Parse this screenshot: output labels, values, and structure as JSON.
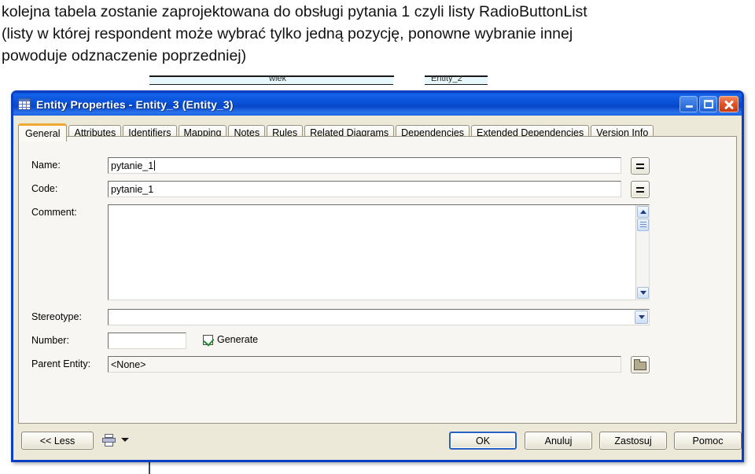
{
  "caption": {
    "line1": "kolejna tabela zostanie zaprojektowana do obsługi pytania 1 czyli listy RadioButtonList",
    "line2": "(listy w której respondent może wybrać tylko jedną pozycję, ponowne wybranie innej",
    "line3": "powoduje odznaczenie poprzedniej)"
  },
  "backdrop": {
    "label_left": "wiek",
    "label_right": "Entity_2"
  },
  "dialog": {
    "title": "Entity Properties - Entity_3 (Entity_3)",
    "icon": "table-grid-icon",
    "window_buttons": {
      "minimize": "minimize-icon",
      "maximize": "maximize-icon",
      "close": "close-icon"
    },
    "tabs": [
      {
        "label": "General",
        "active": true
      },
      {
        "label": "Attributes",
        "active": false
      },
      {
        "label": "Identifiers",
        "active": false
      },
      {
        "label": "Mapping",
        "active": false
      },
      {
        "label": "Notes",
        "active": false
      },
      {
        "label": "Rules",
        "active": false
      },
      {
        "label": "Related Diagrams",
        "active": false
      },
      {
        "label": "Dependencies",
        "active": false
      },
      {
        "label": "Extended Dependencies",
        "active": false
      },
      {
        "label": "Version Info",
        "active": false
      }
    ],
    "fields": {
      "name": {
        "label": "Name:",
        "value": "pytanie_1",
        "button": "="
      },
      "code": {
        "label": "Code:",
        "value": "pytanie_1",
        "button": "="
      },
      "comment": {
        "label": "Comment:",
        "value": ""
      },
      "stereotype": {
        "label": "Stereotype:",
        "value": ""
      },
      "number": {
        "label": "Number:",
        "value": ""
      },
      "generate": {
        "label": "Generate",
        "checked": true
      },
      "parent_entity": {
        "label": "Parent Entity:",
        "value": "<None>"
      }
    },
    "buttons": {
      "less": "<< Less",
      "ok": "OK",
      "cancel": "Anuluj",
      "apply": "Zastosuj",
      "help": "Pomoc"
    }
  },
  "colors": {
    "titlebar_blue": "#0a4fd6",
    "dialog_border": "#0a3fc4",
    "dialog_face": "#ece9d8",
    "active_tab_accent": "#f0a830",
    "close_red": "#e2562a"
  }
}
